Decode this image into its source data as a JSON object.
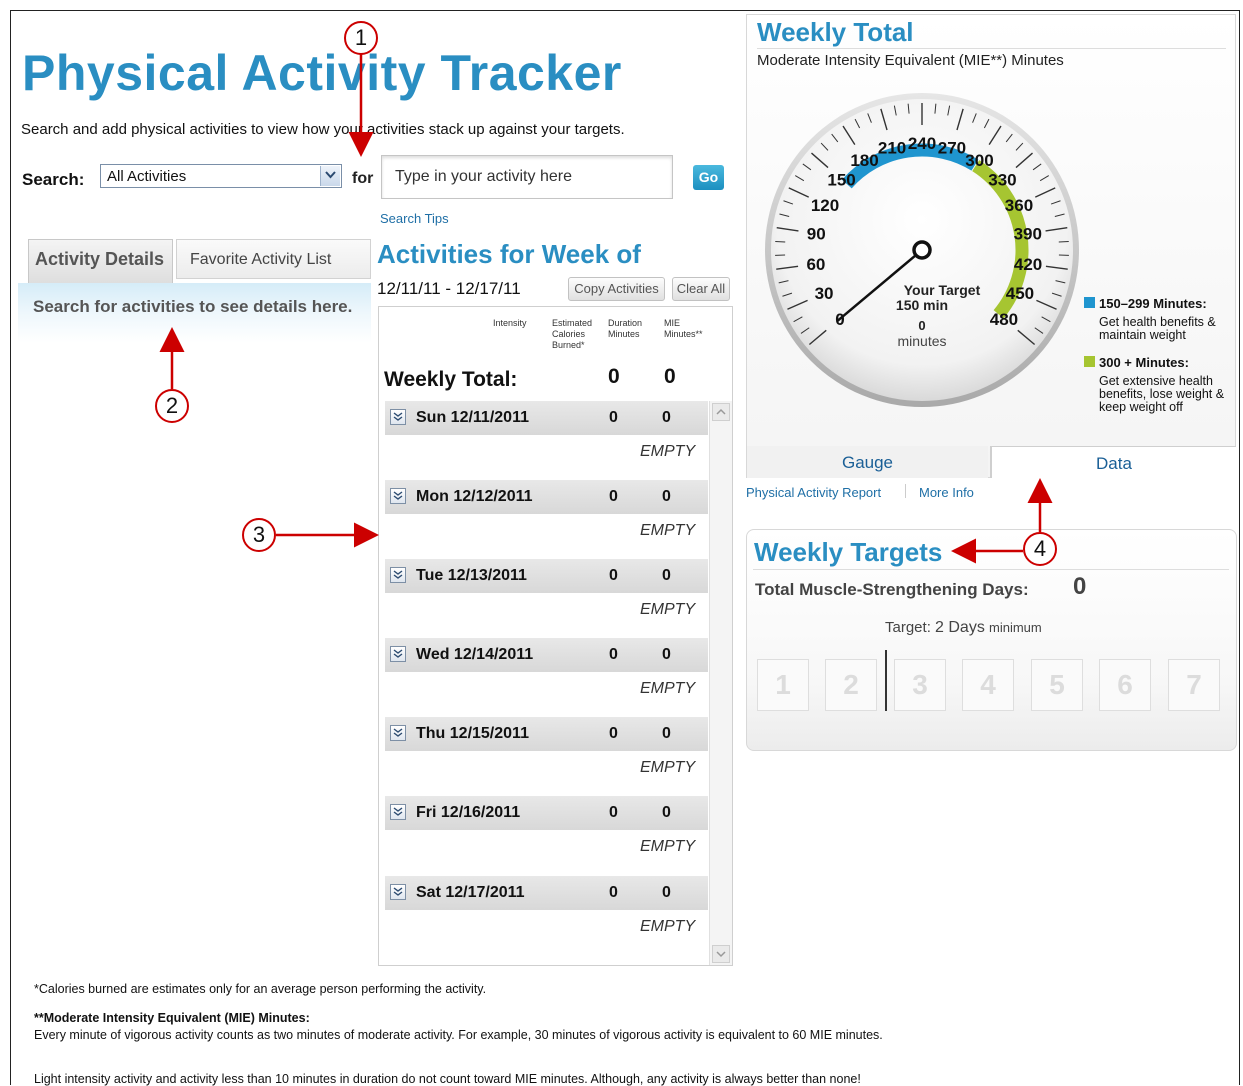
{
  "header": {
    "title": "Physical Activity Tracker",
    "subtitle": "Search and add physical activities to view how your activities stack up against your targets."
  },
  "search": {
    "label": "Search:",
    "category_selected": "All Activities",
    "for_label": "for",
    "placeholder": "Type in your activity here",
    "go_label": "Go",
    "tips_link": "Search Tips"
  },
  "details_tabs": {
    "tabs": [
      {
        "label": "Activity Details",
        "active": true
      },
      {
        "label": "Favorite Activity List",
        "active": false
      }
    ],
    "message": "Search for activities to see details here."
  },
  "activities": {
    "title": "Activities for Week of",
    "week_range": "12/11/11 - 12/17/11",
    "copy_label": "Copy Activities",
    "clear_label": "Clear All",
    "columns": {
      "intensity": "Intensity",
      "calories": "Estimated Calories Burned*",
      "duration": "Duration Minutes",
      "mie": "MIE Minutes**"
    },
    "weekly_total_label": "Weekly Total:",
    "weekly_total_duration": "0",
    "weekly_total_mie": "0",
    "empty_label": "EMPTY",
    "days": [
      {
        "label": "Sun 12/11/2011",
        "duration": "0",
        "mie": "0"
      },
      {
        "label": "Mon 12/12/2011",
        "duration": "0",
        "mie": "0"
      },
      {
        "label": "Tue 12/13/2011",
        "duration": "0",
        "mie": "0"
      },
      {
        "label": "Wed 12/14/2011",
        "duration": "0",
        "mie": "0"
      },
      {
        "label": "Thu 12/15/2011",
        "duration": "0",
        "mie": "0"
      },
      {
        "label": "Fri 12/16/2011",
        "duration": "0",
        "mie": "0"
      },
      {
        "label": "Sat 12/17/2011",
        "duration": "0",
        "mie": "0"
      }
    ]
  },
  "weekly_total": {
    "title": "Weekly Total",
    "subtitle": "Moderate Intensity Equivalent (MIE**) Minutes",
    "gauge": {
      "min": 0,
      "max": 480,
      "value": 0,
      "major_labels": [
        "0",
        "30",
        "60",
        "90",
        "120",
        "150",
        "180",
        "210",
        "240",
        "270",
        "300",
        "330",
        "360",
        "390",
        "420",
        "450",
        "480"
      ],
      "center_label": "Your Target",
      "center_target": "150 min",
      "center_value": "0",
      "center_unit": "minutes",
      "blue_band": [
        150,
        299
      ],
      "green_band": [
        300,
        480
      ],
      "colors": {
        "blue": "#1f95cf",
        "green": "#a6c531",
        "needle": "#111111"
      }
    },
    "legend": [
      {
        "title": "150–299 Minutes:",
        "desc": "Get health benefits & maintain weight",
        "color": "#1f95cf"
      },
      {
        "title": "300 + Minutes:",
        "desc": "Get extensive health benefits, lose weight & keep weight off",
        "color": "#a6c531"
      }
    ],
    "tabs": [
      {
        "label": "Gauge",
        "active": true
      },
      {
        "label": "Data",
        "active": false
      }
    ],
    "links": {
      "report": "Physical Activity Report",
      "info": "More Info"
    }
  },
  "weekly_targets": {
    "title": "Weekly Targets",
    "muscle_label": "Total Muscle-Strengthening Days:",
    "muscle_value": "0",
    "target_prefix": "Target:",
    "target_value": "2 Days",
    "target_suffix": "minimum",
    "days": [
      "1",
      "2",
      "3",
      "4",
      "5",
      "6",
      "7"
    ]
  },
  "footnotes": {
    "calories": "*Calories burned are estimates only for an average person performing the activity.",
    "mie_title": "**Moderate Intensity Equivalent (MIE) Minutes:",
    "mie_text": "Every minute of vigorous activity counts as two minutes of moderate activity. For example, 30 minutes of vigorous activity is equivalent to 60 MIE minutes.",
    "light": "Light intensity activity and activity less than 10 minutes in duration do not count toward MIE minutes. Although, any activity is always better than none!"
  },
  "callouts": [
    "1",
    "2",
    "3",
    "4"
  ]
}
